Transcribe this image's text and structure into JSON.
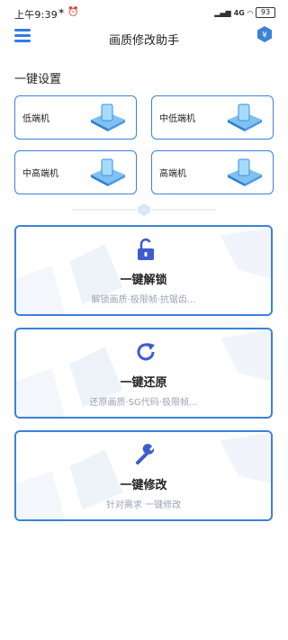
{
  "status": {
    "time": "上午9:39",
    "battery": "93",
    "network_label": "4G"
  },
  "appbar": {
    "title": "画质修改助手"
  },
  "presets": {
    "section_title": "一键设置",
    "items": [
      {
        "label": "低端机"
      },
      {
        "label": "中低端机"
      },
      {
        "label": "中高端机"
      },
      {
        "label": "高端机"
      }
    ]
  },
  "actions": [
    {
      "title": "一键解锁",
      "subtitle": "解锁画质·极限帧·抗锯齿...",
      "icon": "unlock-icon"
    },
    {
      "title": "一键还原",
      "subtitle": "还原画质·SG代码·极限帧...",
      "icon": "refresh-icon"
    },
    {
      "title": "一键修改",
      "subtitle": "针对需求 一键修改",
      "icon": "wrench-icon"
    }
  ],
  "colors": {
    "accent": "#3b82d9",
    "icon_blue": "#3f5bd1"
  }
}
